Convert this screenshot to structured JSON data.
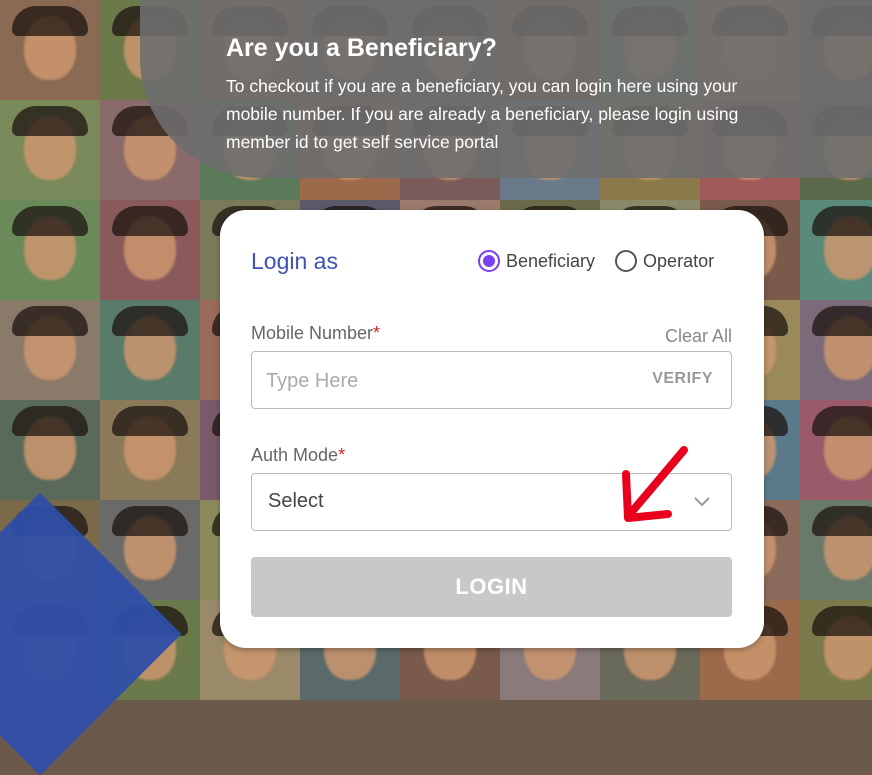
{
  "banner": {
    "title": "Are you a Beneficiary?",
    "text": "To checkout if you are a beneficiary, you can login here using your mobile number. If you are already a beneficiary, please login using member id to get self service portal"
  },
  "login": {
    "heading": "Login as",
    "options": [
      {
        "label": "Beneficiary",
        "selected": true
      },
      {
        "label": "Operator",
        "selected": false
      }
    ],
    "mobile": {
      "label": "Mobile Number",
      "required_mark": "*",
      "placeholder": "Type Here",
      "action": "VERIFY",
      "clear_label": "Clear All"
    },
    "auth_mode": {
      "label": "Auth Mode",
      "required_mark": "*",
      "selected": "Select"
    },
    "submit_label": "LOGIN"
  },
  "colors": {
    "accent": "#3f51b5",
    "radio": "#7b3ff2",
    "required": "#dd2222",
    "annotation_arrow": "#e8001c",
    "disabled_button": "#c8c8c8"
  }
}
